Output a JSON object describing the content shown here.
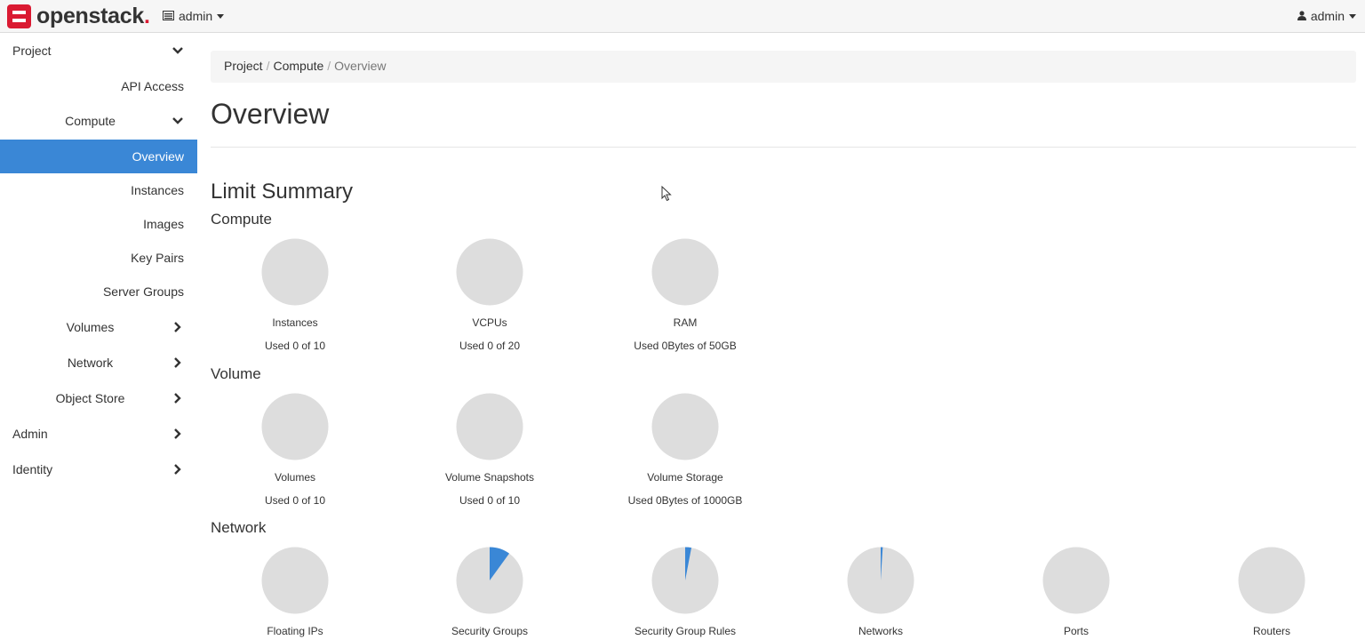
{
  "brand": {
    "name": "openstack",
    "dot": ".",
    "accent": "#da1a32"
  },
  "header": {
    "project_switcher": "admin",
    "user_menu": "admin"
  },
  "sidebar": {
    "items": [
      {
        "label": "Project",
        "chevron": "down"
      },
      {
        "label": "API Access"
      },
      {
        "label": "Compute",
        "chevron": "down"
      },
      {
        "label": "Overview",
        "active": true
      },
      {
        "label": "Instances"
      },
      {
        "label": "Images"
      },
      {
        "label": "Key Pairs"
      },
      {
        "label": "Server Groups"
      },
      {
        "label": "Volumes",
        "chevron": "right"
      },
      {
        "label": "Network",
        "chevron": "right"
      },
      {
        "label": "Object Store",
        "chevron": "right"
      },
      {
        "label": "Admin",
        "chevron": "right"
      },
      {
        "label": "Identity",
        "chevron": "right"
      }
    ]
  },
  "breadcrumb": {
    "items": [
      "Project",
      "Compute",
      "Overview"
    ],
    "separator": "/"
  },
  "page": {
    "title": "Overview",
    "limit_summary": "Limit Summary",
    "sections": [
      {
        "title": "Compute",
        "charts": [
          {
            "name": "Instances",
            "used_text": "Used 0 of 10",
            "fraction": 0
          },
          {
            "name": "VCPUs",
            "used_text": "Used 0 of 20",
            "fraction": 0
          },
          {
            "name": "RAM",
            "used_text": "Used 0Bytes of 50GB",
            "fraction": 0
          }
        ]
      },
      {
        "title": "Volume",
        "charts": [
          {
            "name": "Volumes",
            "used_text": "Used 0 of 10",
            "fraction": 0
          },
          {
            "name": "Volume Snapshots",
            "used_text": "Used 0 of 10",
            "fraction": 0
          },
          {
            "name": "Volume Storage",
            "used_text": "Used 0Bytes of 1000GB",
            "fraction": 0
          }
        ]
      },
      {
        "title": "Network",
        "charts": [
          {
            "name": "Floating IPs",
            "fraction": 0
          },
          {
            "name": "Security Groups",
            "fraction": 0.1
          },
          {
            "name": "Security Group Rules",
            "fraction": 0.03
          },
          {
            "name": "Networks",
            "fraction": 0.01
          },
          {
            "name": "Ports",
            "fraction": 0
          },
          {
            "name": "Routers",
            "fraction": 0
          }
        ]
      }
    ]
  },
  "colors": {
    "pie_empty": "#dddddd",
    "pie_used": "#3a87d6",
    "active_nav": "#3a87d6"
  }
}
